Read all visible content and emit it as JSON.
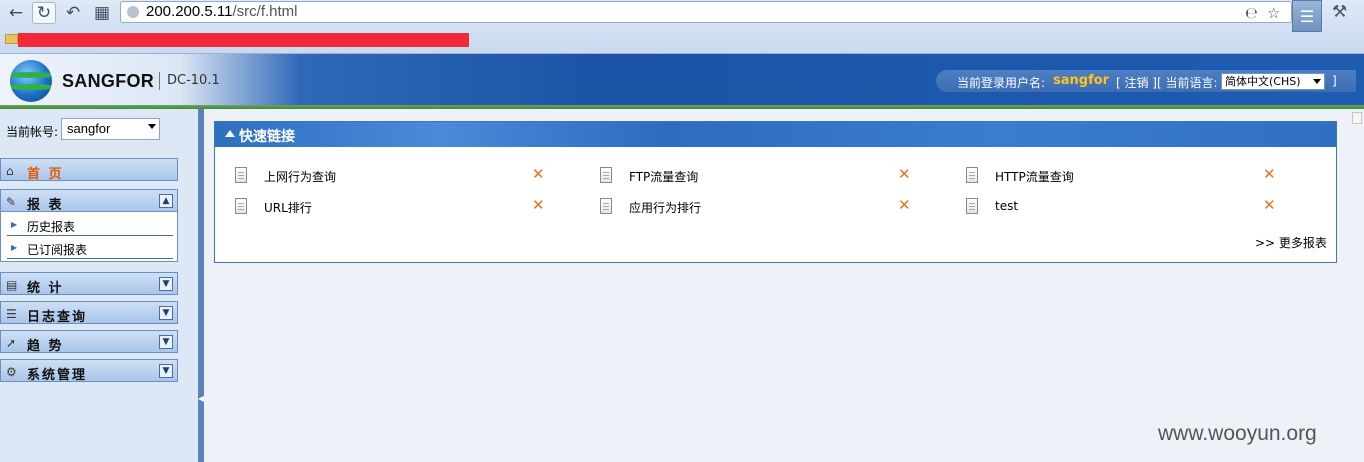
{
  "browser": {
    "url_host": "200.200.5.11",
    "url_path": "/src/f.html"
  },
  "header": {
    "logo_text": "SANGFOR",
    "version": "DC-10.1",
    "user_label": "当前登录用户名:",
    "username": "sangfor",
    "logout_label": "[ 注销 ]",
    "lang_prefix": "[ 当前语言:",
    "lang_value": "简体中文(CHS)",
    "lang_suffix": "]"
  },
  "sidebar": {
    "account_label": "当前帐号:",
    "account_value": "sangfor",
    "menus": [
      {
        "label": "首 页",
        "icon": "home-icon"
      },
      {
        "label": "报 表",
        "icon": "report-icon"
      },
      {
        "label": "统 计",
        "icon": "chart-icon"
      },
      {
        "label": "日志查询",
        "icon": "log-icon"
      },
      {
        "label": "趋 势",
        "icon": "trend-icon"
      },
      {
        "label": "系统管理",
        "icon": "admin-icon"
      }
    ],
    "report_subitems": [
      "历史报表",
      "已订阅报表"
    ]
  },
  "quicklinks": {
    "title": "快速链接",
    "items": [
      "上网行为查询",
      "FTP流量查询",
      "HTTP流量查询",
      "URL排行",
      "应用行为排行",
      "test"
    ],
    "more": ">> 更多报表"
  },
  "watermark": "www.wooyun.org",
  "colors": {
    "accent_blue": "#2e6fc0",
    "username_yellow": "#ffc21f",
    "delete_orange": "#e8741c",
    "home_orange": "#e05b00",
    "redaction_red": "#f0293b"
  }
}
